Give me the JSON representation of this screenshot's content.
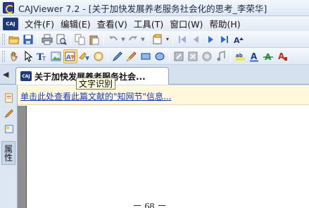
{
  "window": {
    "title": "CAJViewer 7.2 - [关于加快发展养老服务社会化的思考_李荣华]"
  },
  "menubar": {
    "items": [
      "文件(F)",
      "编辑(E)",
      "查看(V)",
      "工具(T)",
      "窗口(W)",
      "帮助(H)"
    ]
  },
  "document_tab": {
    "label": "关于加快发展养老服务社会..."
  },
  "tooltip": {
    "text": "文字识别"
  },
  "info_bar": {
    "link_text": "单击此处查看此篇文献的\"知网节\"信息..."
  },
  "side_panel": {
    "label": "属性"
  },
  "page": {
    "number": "－ 68 －"
  },
  "toolbar": {
    "active_tool": "text-recognition"
  }
}
